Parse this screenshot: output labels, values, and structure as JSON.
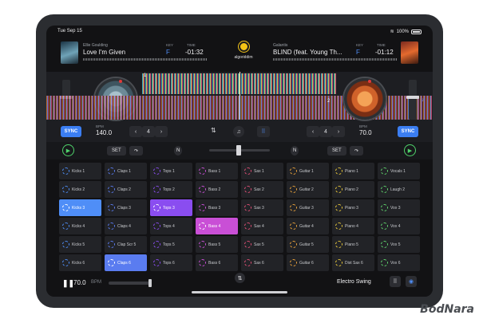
{
  "status": {
    "time": "Tue Sep 15",
    "battery": "100%",
    "wifi_icon": "wifi-icon"
  },
  "deck_left": {
    "artist": "Ellie Goulding",
    "song": "Love I'm Given",
    "key_label": "KEY",
    "key": "F",
    "time_label": "TIME",
    "time": "-01:32",
    "bpm_label": "BPM",
    "bpm": "140.0",
    "wave_number": "1",
    "sync_label": "SYNC",
    "set_label": "SET"
  },
  "deck_right": {
    "artist": "Galantis",
    "song": "BLIND (feat. Young Th...",
    "key_label": "KEY",
    "key": "F",
    "time_label": "TIME",
    "time": "-01:12",
    "bpm_label": "BPM",
    "bpm": "70.0",
    "wave_number": "2",
    "sync_label": "SYNC",
    "set_label": "SET"
  },
  "logo": {
    "text": "algoriddim"
  },
  "pads": [
    {
      "color": "#4f8ef7",
      "items": [
        "Kicks 1",
        "Kicks 2",
        "Kicks 3",
        "Kicks 4",
        "Kicks 5",
        "Kicks 6"
      ],
      "active": 2
    },
    {
      "color": "#5a7cf0",
      "items": [
        "Claps 1",
        "Claps 2",
        "Claps 3",
        "Claps 4",
        "Clap Scr 5",
        "Claps 6"
      ],
      "active": 5
    },
    {
      "color": "#8a4df0",
      "items": [
        "Tops 1",
        "Tops 2",
        "Tops 3",
        "Tops 4",
        "Tops 5",
        "Tops 6"
      ],
      "active": 2
    },
    {
      "color": "#c94fd6",
      "items": [
        "Bass 1",
        "Bass 2",
        "Bass 3",
        "Bass 4",
        "Bass 5",
        "Bass 6"
      ],
      "active": 3
    },
    {
      "color": "#e04f75",
      "items": [
        "Sax 1",
        "Sax 2",
        "Sax 3",
        "Sax 4",
        "Sax 5",
        "Sax 6"
      ],
      "active": -1
    },
    {
      "color": "#e9a23b",
      "items": [
        "Guitar 1",
        "Guitar 2",
        "Guitar 3",
        "Guitar 4",
        "Guitar 5",
        "Guitar 6"
      ],
      "active": -1
    },
    {
      "color": "#e5c53a",
      "items": [
        "Piano 1",
        "Piano 2",
        "Piano 3",
        "Piano 4",
        "Piano 5",
        "Dist Sax 6"
      ],
      "active": -1
    },
    {
      "color": "#5fd36c",
      "items": [
        "Vocals 1",
        "Laugh 2",
        "Vox 3",
        "Vox 4",
        "Vox 5",
        "Vox 6"
      ],
      "active": -1
    }
  ],
  "bottom": {
    "bpm": "70.0",
    "bpm_label": "BPM",
    "genre": "Electro Swing"
  },
  "watermark": "BodNara",
  "colors": {
    "accent": "#3b7ef2",
    "play": "#4fd26a",
    "logo": "#f4c516"
  }
}
